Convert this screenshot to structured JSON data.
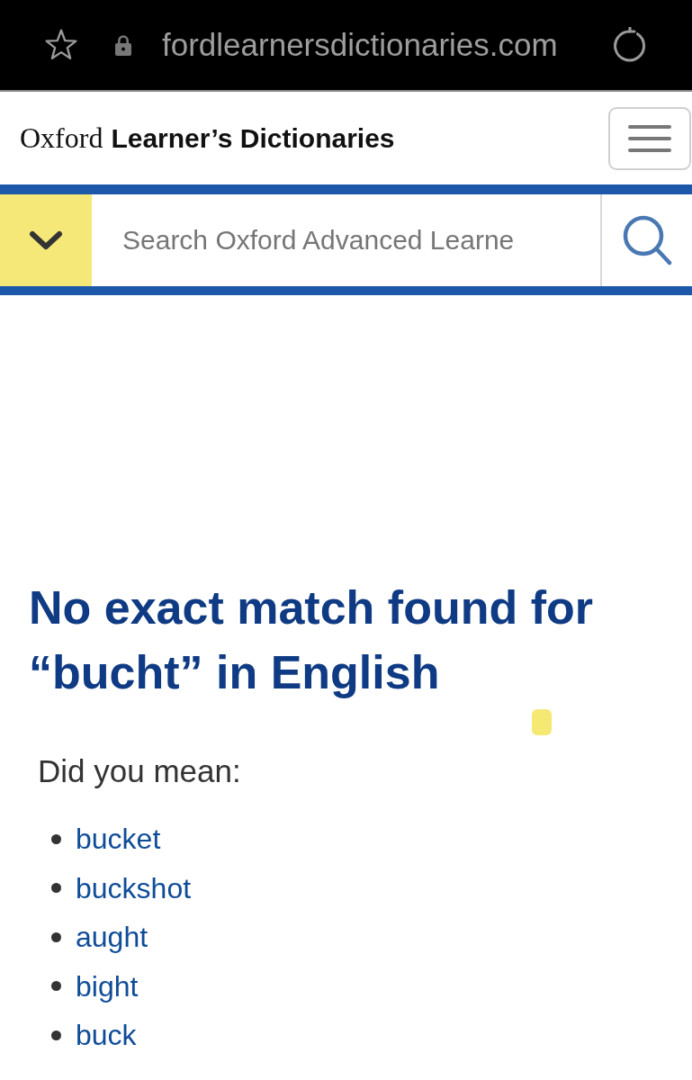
{
  "browser_bar": {
    "url": "fordlearnersdictionaries.com"
  },
  "header": {
    "logo_serif": "Oxford",
    "logo_bold": "Learner’s Dictionaries"
  },
  "search": {
    "placeholder": "Search Oxford Advanced Learne"
  },
  "results": {
    "heading": "No exact match found for “bucht” in English",
    "prompt": "Did you mean:",
    "suggestions": [
      "bucket",
      "buckshot",
      "aught",
      "bight",
      "buck"
    ]
  }
}
